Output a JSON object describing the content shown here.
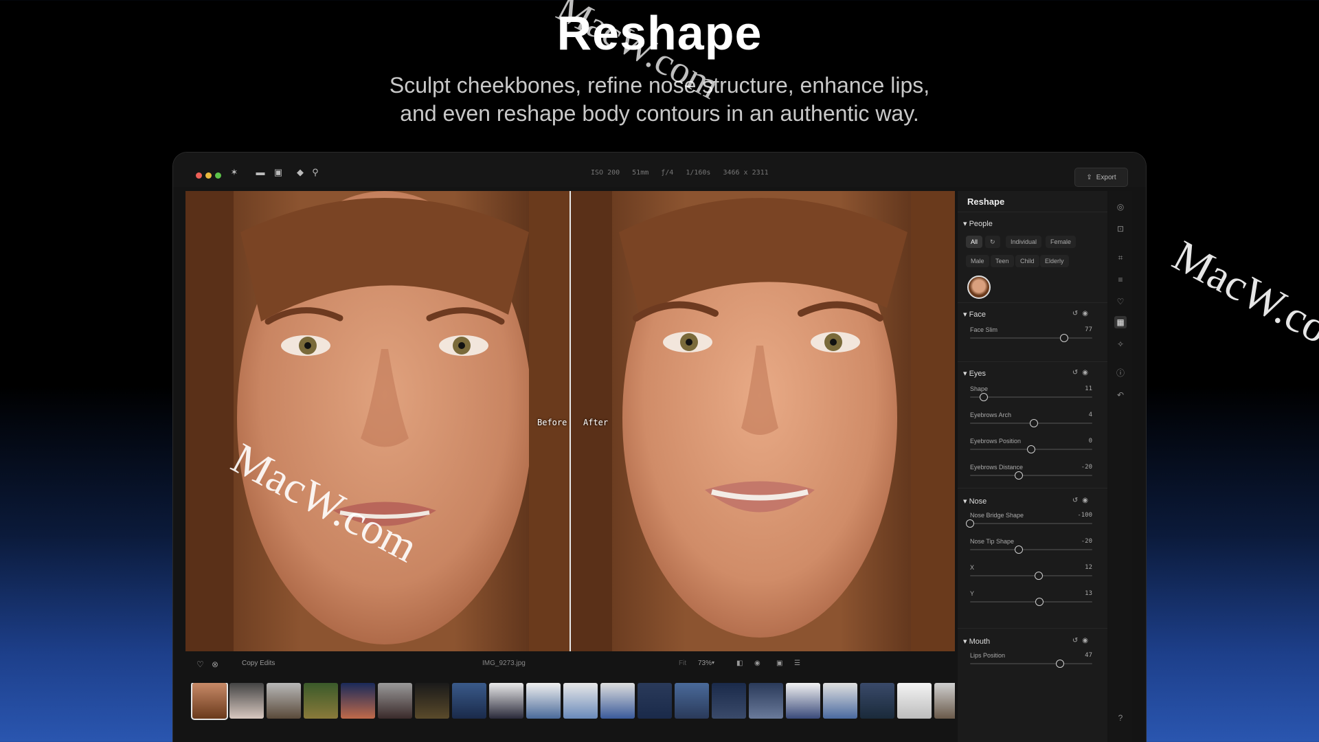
{
  "hero": {
    "title": "Reshape",
    "subtitle_line1": "Sculpt cheekbones, refine nose structure, enhance lips,",
    "subtitle_line2": "and even reshape body contours in an authentic way."
  },
  "watermark": "MacW.com",
  "titlebar": {
    "meta": [
      "ISO 200",
      "51mm",
      "ƒ/4",
      "1/160s",
      "3466 x 2311"
    ],
    "export_label": "Export",
    "tools": [
      "star-icon",
      "folder-icon",
      "image-icon",
      "eraser-icon",
      "zoom-icon"
    ]
  },
  "compare": {
    "before": "Before",
    "after": "After"
  },
  "bottombar": {
    "copy_edits": "Copy Edits",
    "filename": "IMG_9273.jpg",
    "fit": "Fit",
    "zoom": "73%"
  },
  "panel": {
    "title": "Reshape",
    "people": {
      "title": "People",
      "filters_row1": [
        "All",
        "Individual",
        "Female"
      ],
      "filters_row2": [
        "Male",
        "Teen",
        "Child",
        "Elderly"
      ],
      "active_filter": "All"
    },
    "face": {
      "title": "Face",
      "sliders": [
        {
          "label": "Face Slim",
          "value": "77",
          "pos": 0.77
        }
      ]
    },
    "eyes": {
      "title": "Eyes",
      "sliders": [
        {
          "label": "Shape",
          "value": "11",
          "pos": 0.11
        },
        {
          "label": "Eyebrows Arch",
          "value": "4",
          "pos": 0.52
        },
        {
          "label": "Eyebrows Position",
          "value": "0",
          "pos": 0.5
        },
        {
          "label": "Eyebrows Distance",
          "value": "-20",
          "pos": 0.4
        }
      ]
    },
    "nose": {
      "title": "Nose",
      "sliders": [
        {
          "label": "Nose Bridge Shape",
          "value": "-100",
          "pos": 0.0
        },
        {
          "label": "Nose Tip Shape",
          "value": "-20",
          "pos": 0.4
        },
        {
          "label": "X",
          "value": "12",
          "pos": 0.56
        },
        {
          "label": "Y",
          "value": "13",
          "pos": 0.565
        }
      ]
    },
    "mouth": {
      "title": "Mouth",
      "sliders": [
        {
          "label": "Lips Position",
          "value": "47",
          "pos": 0.735
        }
      ]
    }
  },
  "rail_icons": [
    "mask-icon",
    "select-icon",
    "crop-icon",
    "sliders-icon",
    "heart-shield-icon",
    "reshape-icon",
    "magic-icon",
    "info-icon",
    "undo-icon",
    "help-icon"
  ],
  "colors": {
    "accent_selected": "#e6e6e6",
    "panel_bg": "#1b1b1b"
  }
}
